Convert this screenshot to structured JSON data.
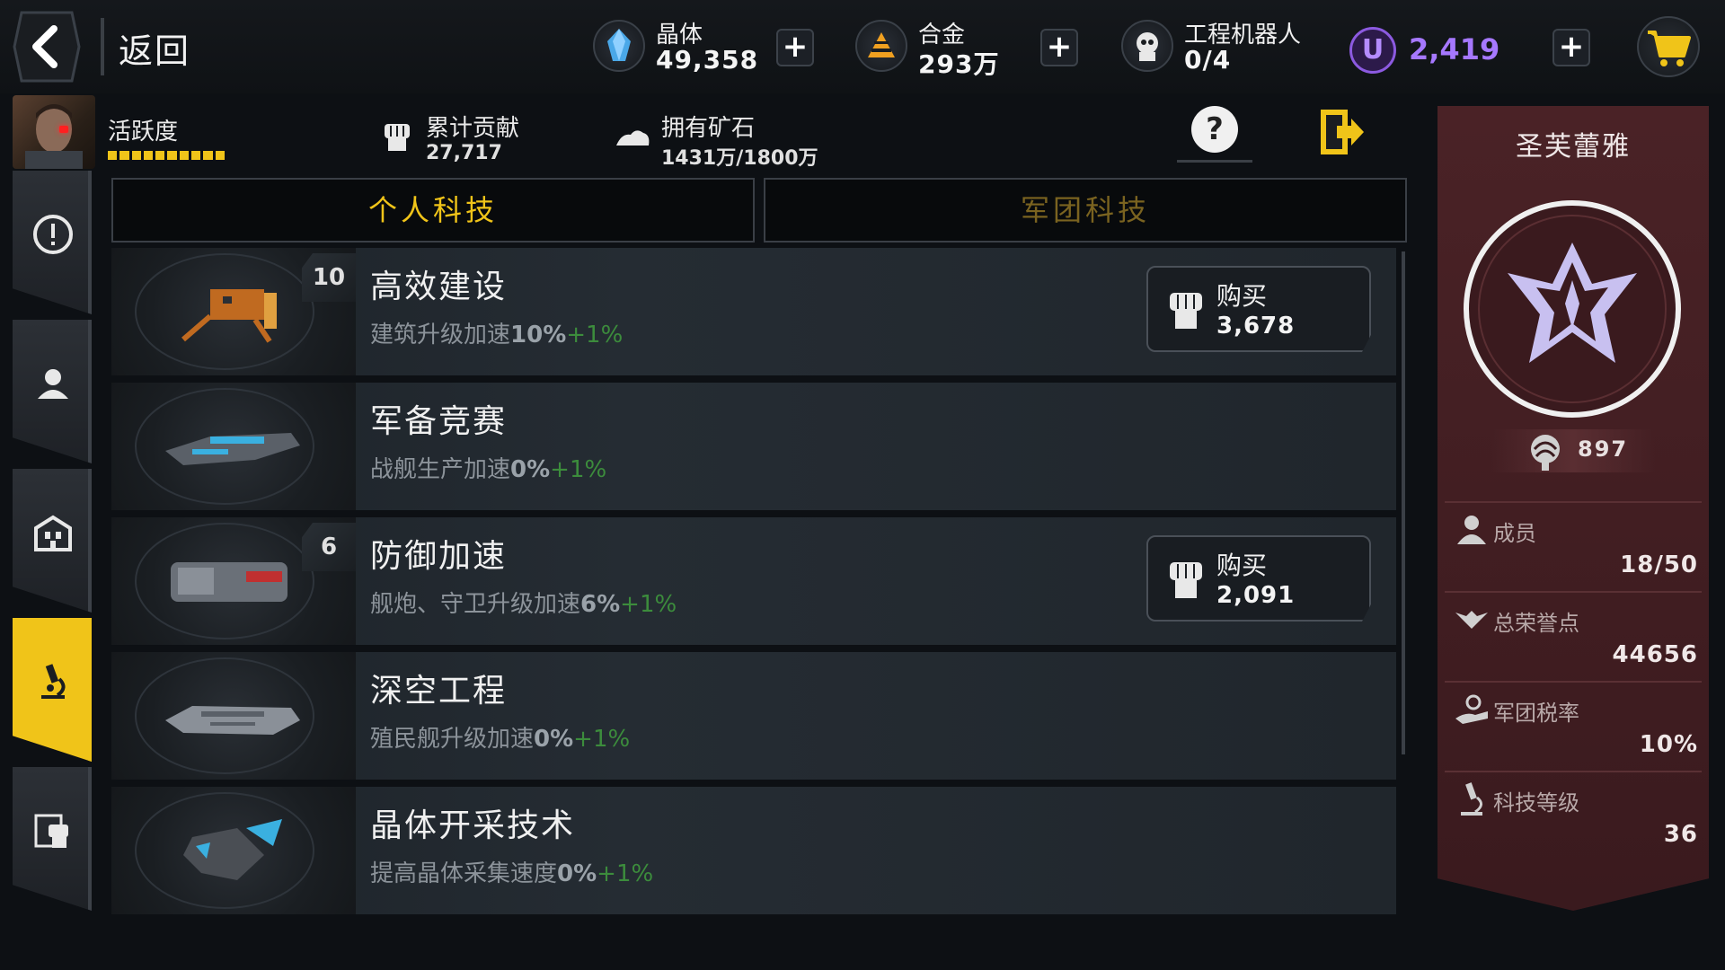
{
  "topbar": {
    "back_label": "返回",
    "resources": [
      {
        "name": "晶体",
        "value": "49,358",
        "icon": "crystal-icon"
      },
      {
        "name": "合金",
        "value": "293万",
        "icon": "alloy-icon"
      },
      {
        "name": "工程机器人",
        "value": "0/4",
        "icon": "robot-icon"
      }
    ],
    "premium": {
      "symbol": "U",
      "value": "2,419"
    },
    "cart_icon": "cart-icon"
  },
  "header": {
    "activity_label": "活跃度",
    "activity_segments": 10,
    "contribution": {
      "label": "累计贡献",
      "value": "27,717"
    },
    "ore": {
      "label": "拥有矿石",
      "value": "1431万/1800万"
    }
  },
  "tabs": [
    {
      "label": "个人科技",
      "active": true
    },
    {
      "label": "军团科技",
      "active": false
    }
  ],
  "techs": [
    {
      "title": "高效建设",
      "desc_prefix": "建筑升级加速",
      "pct": "10%",
      "inc": "+1%",
      "level": "10",
      "buy_label": "购买",
      "price": "3,678"
    },
    {
      "title": "军备竞赛",
      "desc_prefix": "战舰生产加速",
      "pct": "0%",
      "inc": "+1%",
      "level": "",
      "buy_label": "",
      "price": ""
    },
    {
      "title": "防御加速",
      "desc_prefix": "舰炮、守卫升级加速",
      "pct": "6%",
      "inc": "+1%",
      "level": "6",
      "buy_label": "购买",
      "price": "2,091"
    },
    {
      "title": "深空工程",
      "desc_prefix": "殖民舰升级加速",
      "pct": "0%",
      "inc": "+1%",
      "level": "",
      "buy_label": "",
      "price": ""
    },
    {
      "title": "晶体开采技术",
      "desc_prefix": "提高晶体采集速度",
      "pct": "0%",
      "inc": "+1%",
      "level": "",
      "buy_label": "",
      "price": ""
    }
  ],
  "legion": {
    "name": "圣芙蕾雅",
    "score": "897",
    "stats": [
      {
        "label": "成员",
        "value": "18/50",
        "icon": "member-icon"
      },
      {
        "label": "总荣誉点",
        "value": "44656",
        "icon": "wings-icon"
      },
      {
        "label": "军团税率",
        "value": "10%",
        "icon": "tax-icon"
      },
      {
        "label": "科技等级",
        "value": "36",
        "icon": "microscope-icon"
      }
    ]
  },
  "colors": {
    "accent": "#f0c419",
    "premium": "#a678ff",
    "increment": "#3c8c3c",
    "panel": "#4a2226"
  }
}
